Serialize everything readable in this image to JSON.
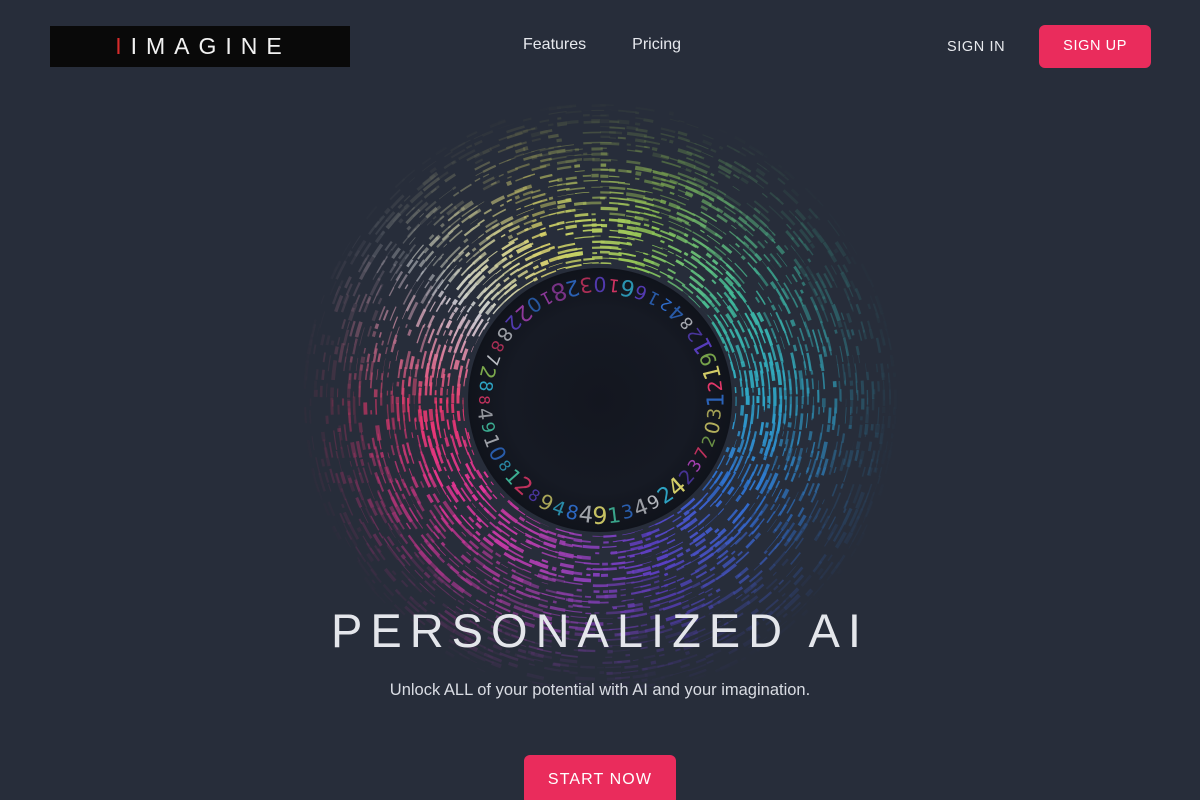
{
  "page": {
    "background_color": "#272d3a",
    "accent_color": "#ea2c5c"
  },
  "header": {
    "logo": {
      "accent_letter": "I",
      "text": "IMAGINE",
      "accent_color": "#d62b2b",
      "box_color": "#090909"
    },
    "nav": [
      {
        "label": "Features"
      },
      {
        "label": "Pricing"
      }
    ],
    "auth": {
      "sign_in_label": "SIGN IN",
      "sign_up_label": "SIGN UP"
    }
  },
  "hero": {
    "headline": "PERSONALIZED AI",
    "subtitle": "Unlock ALL of your potential with AI and your imagination.",
    "cta_label": "START NOW",
    "artwork": {
      "name": "radial-data-visualization",
      "center_digits": "0 1 6 6 1 2 4 8 2 1 9 1 2 1 3 0 2 7 3 2 4 2 9 4 3 1 9 4 8 4 9 8 2 1 8 0 1 9 4 8 8 2 7 8 8 2 2 0 1 8 2 3",
      "palette": [
        "#c9ccd2",
        "#d9d36a",
        "#8fc455",
        "#3fb89a",
        "#2fa8c9",
        "#2f6fd0",
        "#5b3fc4",
        "#a33fb0",
        "#e0359a",
        "#e8386b"
      ]
    }
  }
}
